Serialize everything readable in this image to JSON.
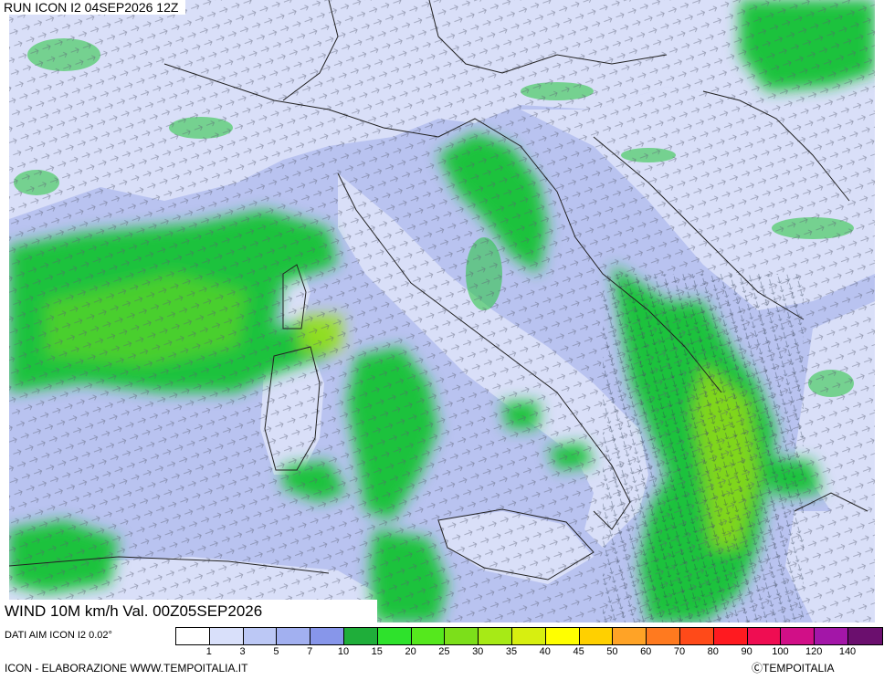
{
  "map": {
    "run_label": "RUN ICON I2 04SEP2026 12Z",
    "title": "WIND 10M km/h Val. 00Z05SEP2026",
    "source_note": "DATI AIM ICON I2 0.02°",
    "credits": "ICON - ELABORAZIONE WWW.TEMPOITALIA.IT",
    "logo_text": "ⒸTEMPOITALIA",
    "colors": {
      "sea_calm": "#b9c3f0",
      "land_calm": "#d9dff8",
      "wind_strong": "#22c43a",
      "wind_peak": "#7ad21c",
      "border_line": "#222222"
    }
  },
  "legend": {
    "unit": "km/h",
    "steps": [
      {
        "color": "#ffffff"
      },
      {
        "color": "#d9e0fa"
      },
      {
        "color": "#bcc8f5"
      },
      {
        "color": "#a2b0f0"
      },
      {
        "color": "#8796ea"
      },
      {
        "color": "#1fae3a"
      },
      {
        "color": "#2ee22c"
      },
      {
        "color": "#55e81d"
      },
      {
        "color": "#7cdf1a"
      },
      {
        "color": "#a7ea16"
      },
      {
        "color": "#d7ef10"
      },
      {
        "color": "#ffff00"
      },
      {
        "color": "#ffd000"
      },
      {
        "color": "#ffa326"
      },
      {
        "color": "#ff7a1f"
      },
      {
        "color": "#ff4a19"
      },
      {
        "color": "#ff1a20"
      },
      {
        "color": "#ef0d52"
      },
      {
        "color": "#d10f87"
      },
      {
        "color": "#a316a8"
      },
      {
        "color": "#6b0f6e"
      }
    ],
    "tick_labels": [
      "1",
      "3",
      "5",
      "7",
      "10",
      "15",
      "20",
      "25",
      "30",
      "35",
      "40",
      "45",
      "50",
      "60",
      "70",
      "80",
      "90",
      "100",
      "120",
      "140"
    ]
  }
}
